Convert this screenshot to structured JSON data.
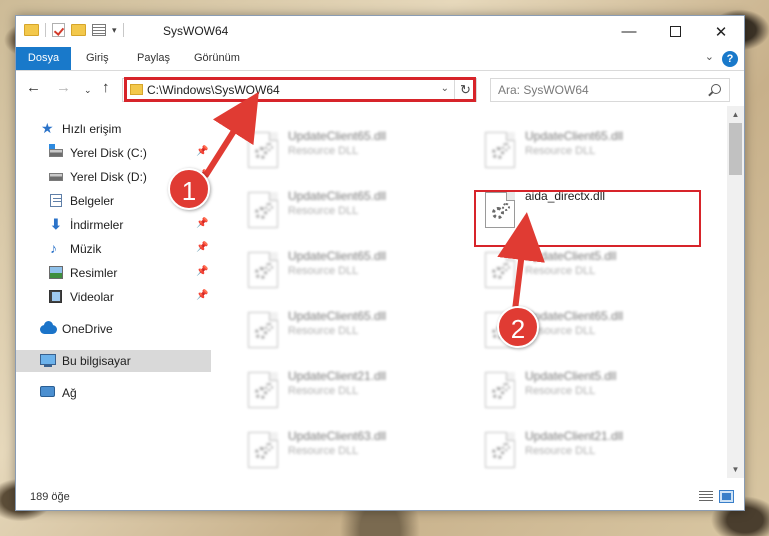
{
  "window": {
    "title": "SysWOW64",
    "controls": {
      "minimize": "—",
      "maximize": "",
      "close": "✕"
    }
  },
  "ribbon": {
    "tabs": [
      "Dosya",
      "Giriş",
      "Paylaş",
      "Görünüm"
    ],
    "help": "?",
    "expand": "⌄"
  },
  "navigation": {
    "back": "←",
    "forward": "→",
    "recent": "⌄",
    "up": "↑",
    "address": "C:\\Windows\\SysWOW64",
    "address_dropdown": "⌄",
    "refresh": "↻",
    "search_placeholder": "Ara: SysWOW64"
  },
  "nav_pane": {
    "items": [
      {
        "label": "Hızlı erişim",
        "icon": "star-icon",
        "pinned": false
      },
      {
        "label": "Yerel Disk (C:)",
        "icon": "drive-c-icon",
        "pinned": true
      },
      {
        "label": "Yerel Disk (D:)",
        "icon": "drive-icon",
        "pinned": true
      },
      {
        "label": "Belgeler",
        "icon": "documents-icon",
        "pinned": true
      },
      {
        "label": "İndirmeler",
        "icon": "downloads-icon",
        "pinned": true
      },
      {
        "label": "Müzik",
        "icon": "music-icon",
        "pinned": true
      },
      {
        "label": "Resimler",
        "icon": "pictures-icon",
        "pinned": true
      },
      {
        "label": "Videolar",
        "icon": "videos-icon",
        "pinned": true
      },
      {
        "label": "OneDrive",
        "icon": "onedrive-icon",
        "pinned": false
      },
      {
        "label": "Bu bilgisayar",
        "icon": "this-pc-icon",
        "pinned": false,
        "selected": true
      },
      {
        "label": "Ağ",
        "icon": "network-icon",
        "pinned": false
      }
    ],
    "pin_glyph": "📌"
  },
  "files": [
    {
      "name": "UpdateClient65.dll",
      "type": "Resource DLL",
      "blurred": true
    },
    {
      "name": "UpdateClient65.dll",
      "type": "Resource DLL",
      "blurred": true
    },
    {
      "name": "UpdateClient65.dll",
      "type": "Resource DLL",
      "blurred": true
    },
    {
      "name": "aida_directx.dll",
      "type": "",
      "blurred": false,
      "highlighted": true
    },
    {
      "name": "UpdateClient65.dll",
      "type": "Resource DLL",
      "blurred": true
    },
    {
      "name": "UpdateClient5.dll",
      "type": "Resource DLL",
      "blurred": true
    },
    {
      "name": "UpdateClient65.dll",
      "type": "Resource DLL",
      "blurred": true
    },
    {
      "name": "UpdateClient65.dll",
      "type": "Resource DLL",
      "blurred": true
    },
    {
      "name": "UpdateClient21.dll",
      "type": "Resource DLL",
      "blurred": true
    },
    {
      "name": "UpdateClient5.dll",
      "type": "Resource DLL",
      "blurred": true
    },
    {
      "name": "UpdateClient63.dll",
      "type": "Resource DLL",
      "blurred": true
    },
    {
      "name": "UpdateClient21.dll",
      "type": "Resource DLL",
      "blurred": true
    }
  ],
  "status": {
    "item_count": "189 öğe"
  },
  "annotations": [
    {
      "number": "1"
    },
    {
      "number": "2"
    }
  ],
  "colors": {
    "accent": "#1979ca",
    "highlight": "#d7242a",
    "callout": "#e03b33"
  }
}
